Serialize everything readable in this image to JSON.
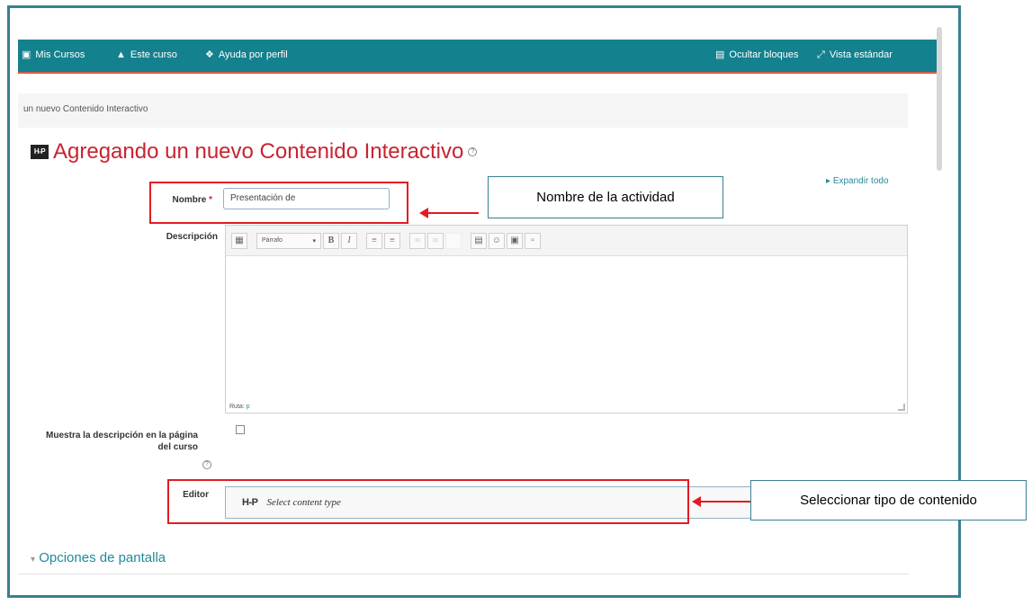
{
  "navbar": {
    "items": [
      {
        "icon": "briefcase-icon",
        "label": "Mis Cursos"
      },
      {
        "icon": "sitemap-icon",
        "label": "Este curso"
      },
      {
        "icon": "lifebuoy-icon",
        "label": "Ayuda por perfil"
      }
    ],
    "hide_blocks": "Ocultar bloques",
    "standard_view": "Vista estándar",
    "color": "#13818e"
  },
  "breadcrumb": "un nuevo Contenido Interactivo",
  "page": {
    "title": "Agregando un nuevo Contenido Interactivo",
    "title_icon": "H-P",
    "expand_all": "Expandir todo"
  },
  "form": {
    "name_label": "Nombre",
    "name_value": "Presentación de",
    "description_label": "Descripción",
    "format_select": "Párrafo",
    "path_label": "Ruta:",
    "path_value": "p",
    "show_description_label_1": "Muestra la descripción en la página",
    "show_description_label_2": "del curso",
    "editor_label": "Editor",
    "h5p_logo": "H-P",
    "select_content_type": "Select content type",
    "display_options": "Opciones de pantalla"
  },
  "annotations": {
    "name_callout": "Nombre de la actividad",
    "content_type_callout": "Seleccionar tipo de contenido",
    "highlight_color": "#e31b23"
  }
}
